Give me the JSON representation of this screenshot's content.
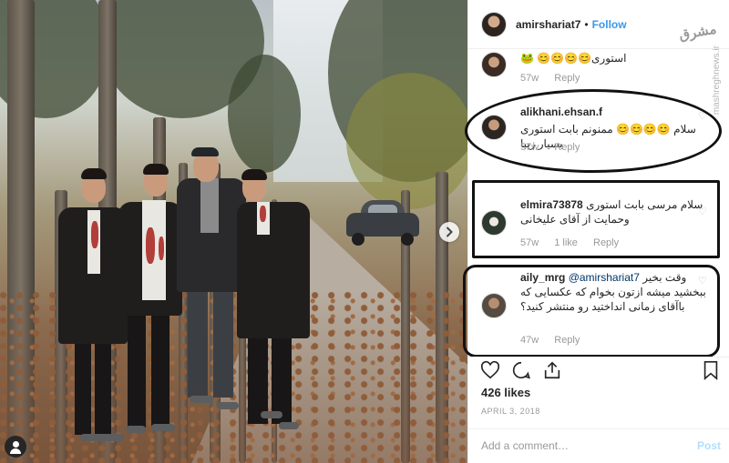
{
  "header": {
    "username": "amirshariat7",
    "separator": "•",
    "follow_label": "Follow"
  },
  "watermark": {
    "logo": "مشرق",
    "site": "mashreghnews.ir"
  },
  "comments": [
    {
      "username": "",
      "text": "استوری😊😊😊😊 🐸",
      "age": "57w",
      "reply_label": "Reply"
    },
    {
      "username": "alikhani.ehsan.f",
      "text": "سلام 😊😊😊😊 ممنونم بابت استوری بسیار زیبا",
      "age": "57w",
      "reply_label": "Reply"
    },
    {
      "username": "elmira73878",
      "text": "سلام مرسی بابت استوری وحمایت از آقای علیخانی",
      "age": "57w",
      "likes_label": "1 like",
      "reply_label": "Reply"
    },
    {
      "username": "aily_mrg",
      "mention": "@amirshariat7",
      "text": "وقت بخیر ببخشید میشه ازتون بخوام که عکسایی که باآقای زمانی انداختید رو منتشر کنید؟",
      "age": "47w",
      "reply_label": "Reply"
    }
  ],
  "actions": {
    "likes": "426 likes",
    "date": "APRIL 3, 2018"
  },
  "add_comment": {
    "placeholder": "Add a comment…",
    "post_label": "Post"
  },
  "icons": {
    "next": "chevron-right-icon",
    "tag": "user-tag-icon",
    "like": "heart-icon",
    "comment": "comment-icon",
    "share": "share-icon",
    "save": "bookmark-icon"
  }
}
